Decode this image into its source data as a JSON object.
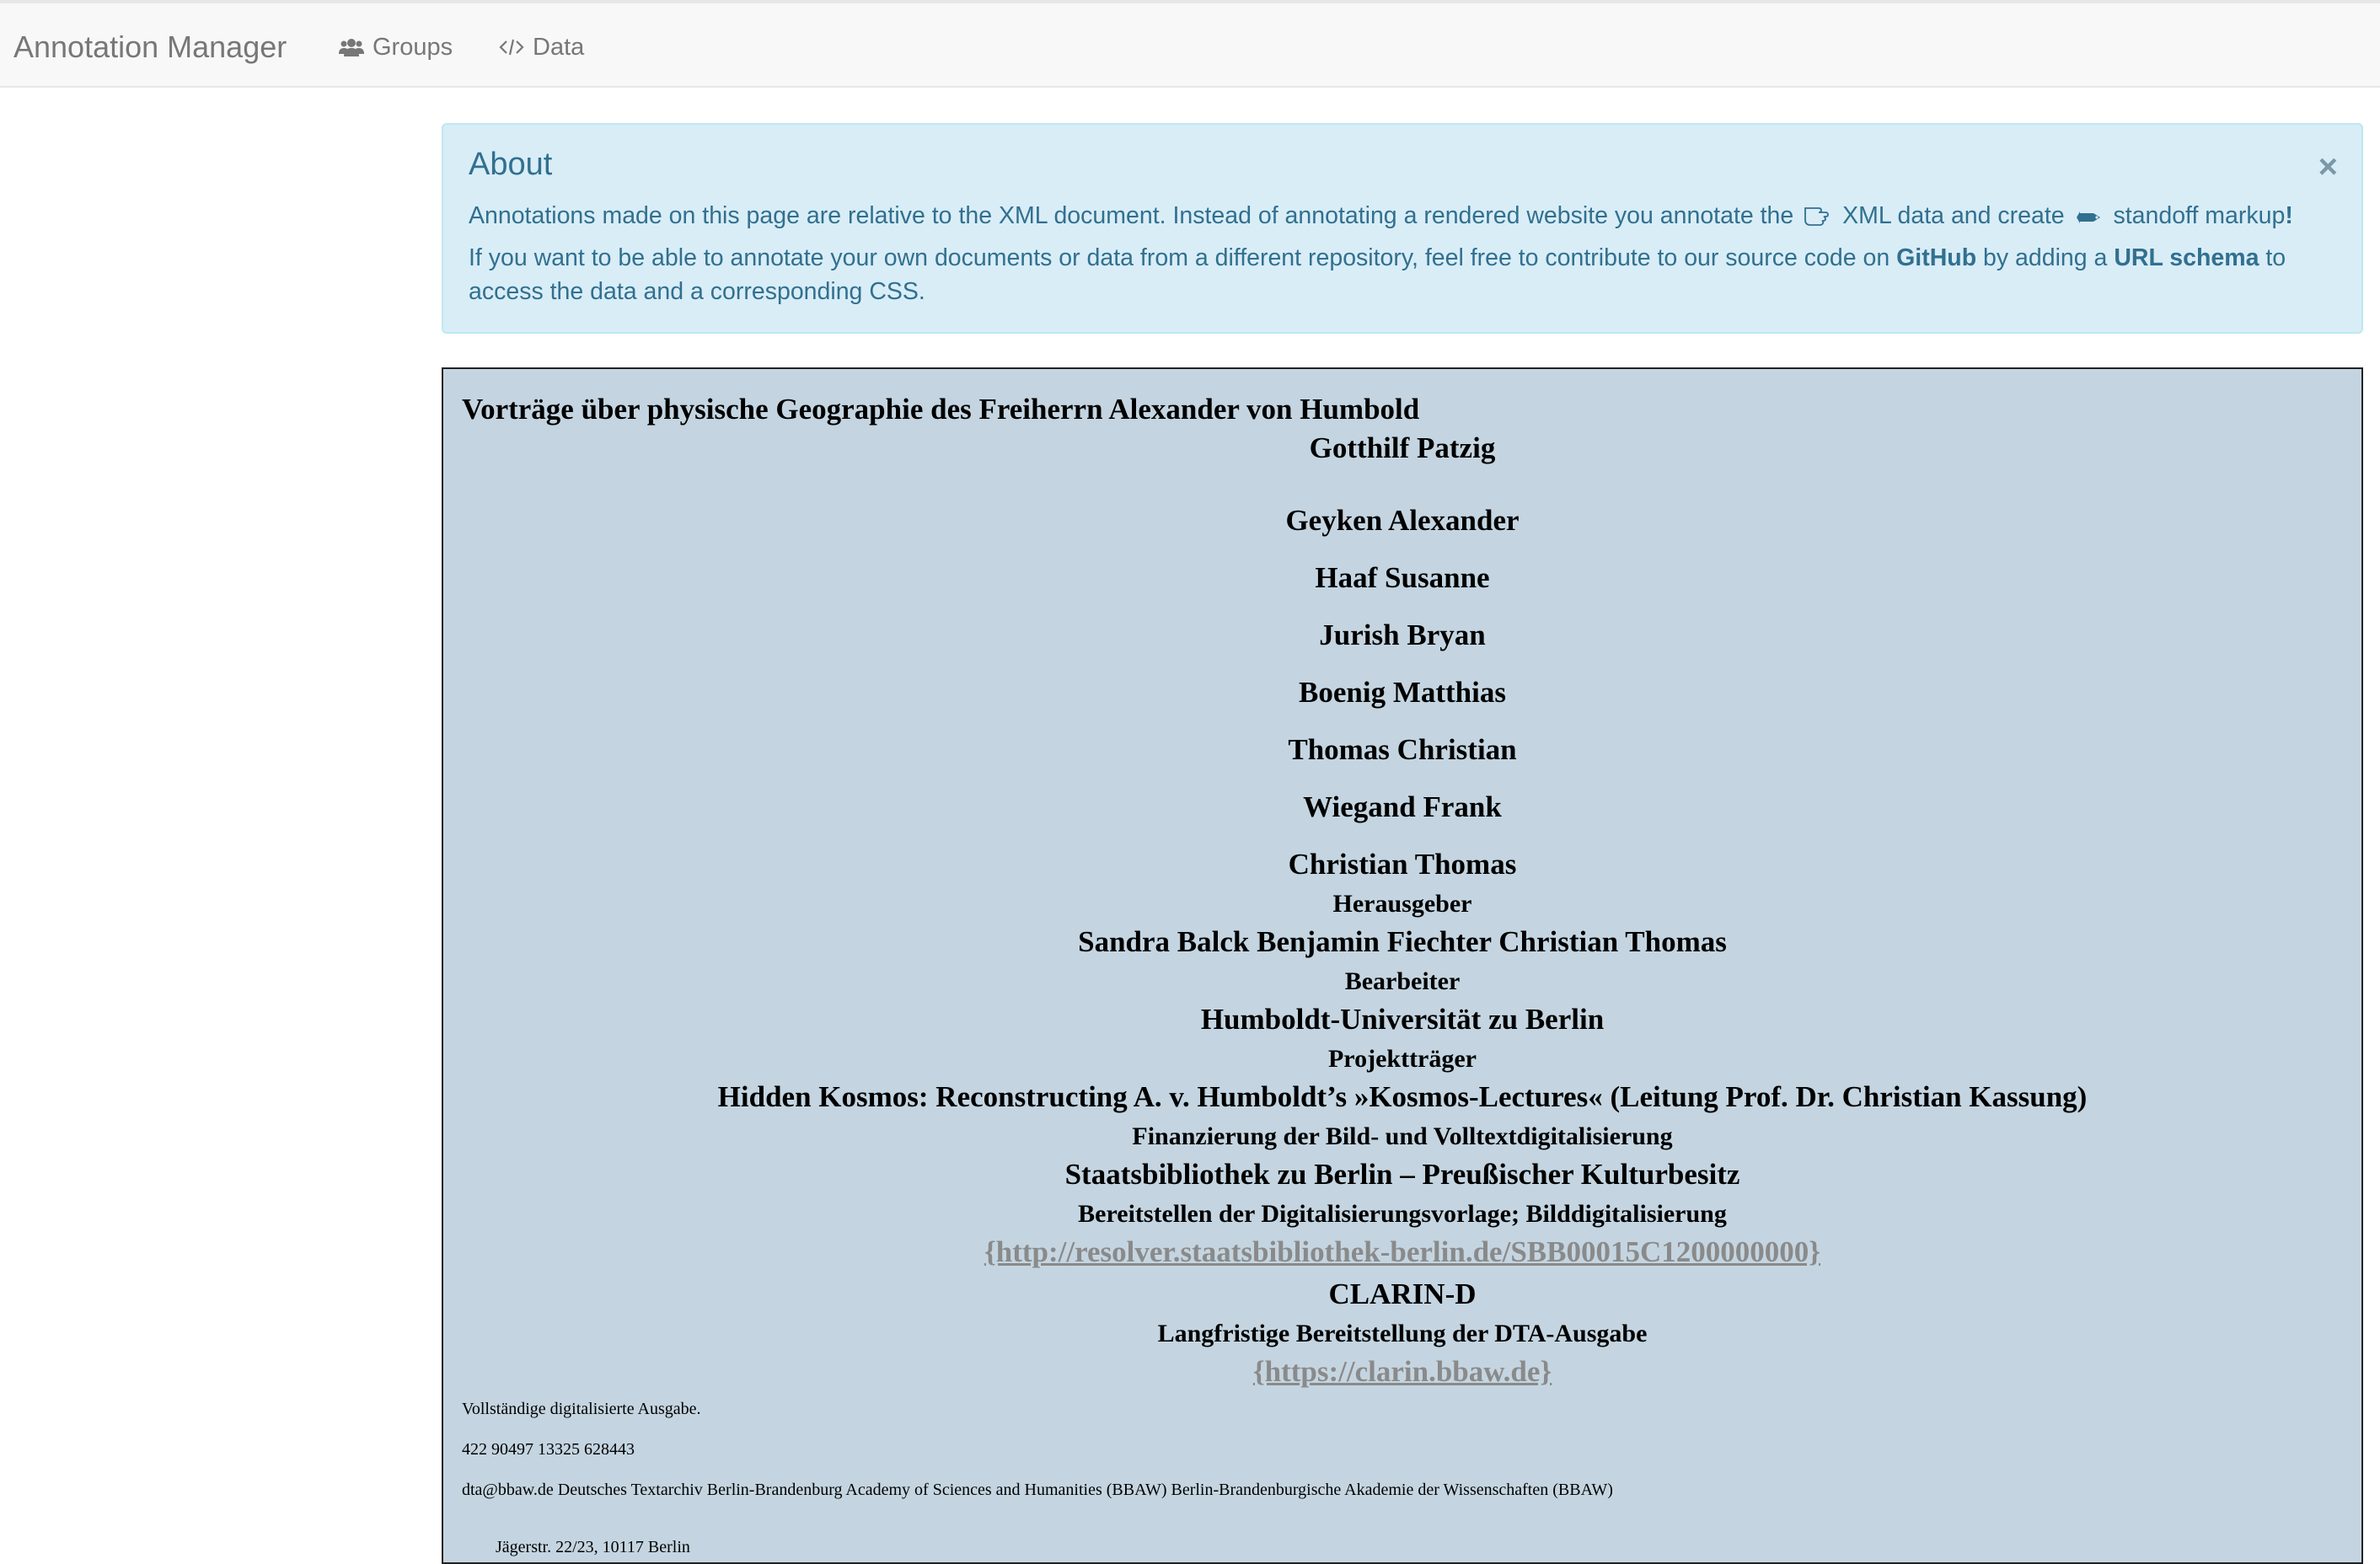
{
  "navbar": {
    "brand": "Annotation Manager",
    "groups_label": "Groups",
    "data_label": "Data"
  },
  "about": {
    "title": "About",
    "close_symbol": "×",
    "p1_part1": "Annotations made on this page are relative to the XML document. Instead of annotating a rendered website you annotate the",
    "p1_part2": "XML data and create",
    "p1_part3": "standoff markup",
    "p1_end": "!",
    "p2_part1": "If you want to be able to annotate your own documents or data from a different repository, feel free to contribute to our source code on",
    "p2_github": "GitHub",
    "p2_part2": "by adding a",
    "p2_url_schema": "URL schema",
    "p2_part3": "to access the data and a corresponding CSS."
  },
  "document": {
    "heading": "Vorträge über physische Geographie des Freiherrn Alexander von Humbold",
    "author": "Gotthilf Patzig",
    "editors": [
      "Geyken Alexander",
      "Haaf Susanne",
      "Jurish Bryan",
      "Boenig Matthias",
      "Thomas Christian",
      "Wiegand Frank",
      "Christian Thomas"
    ],
    "role_herausgeber": "Herausgeber",
    "bearbeiter_names": "Sandra Balck Benjamin Fiechter Christian Thomas",
    "role_bearbeiter": "Bearbeiter",
    "university": "Humboldt-Universität zu Berlin",
    "role_projekttraeger": "Projektträger",
    "project": "Hidden Kosmos: Reconstructing A. v. Humboldt’s »Kosmos-Lectures« (Leitung Prof. Dr. Christian Kassung)",
    "role_finanzierung": "Finanzierung der Bild- und Volltextdigitalisierung",
    "library": "Staatsbibliothek zu Berlin – Preußischer Kulturbesitz",
    "role_bereitstellen": "Bereitstellen der Digitalisierungsvorlage; Bilddigitalisierung",
    "resolver_link": "{http://resolver.staatsbibliothek-berlin.de/SBB00015C1200000000}",
    "clarin": "CLARIN-D",
    "role_langfristige": "Langfristige Bereitstellung der DTA-Ausgabe",
    "clarin_link": "{https://clarin.bbaw.de}",
    "vollstaendig": "Vollständige digitalisierte Ausgabe.",
    "numbers": "422 90497 13325 628443",
    "contact": "dta@bbaw.de Deutsches Textarchiv Berlin-Brandenburg Academy of Sciences and Humanities (BBAW) Berlin-Brandenburgische Akademie der Wissenschaften (BBAW)",
    "address": "Jägerstr. 22/23, 10117 Berlin"
  }
}
